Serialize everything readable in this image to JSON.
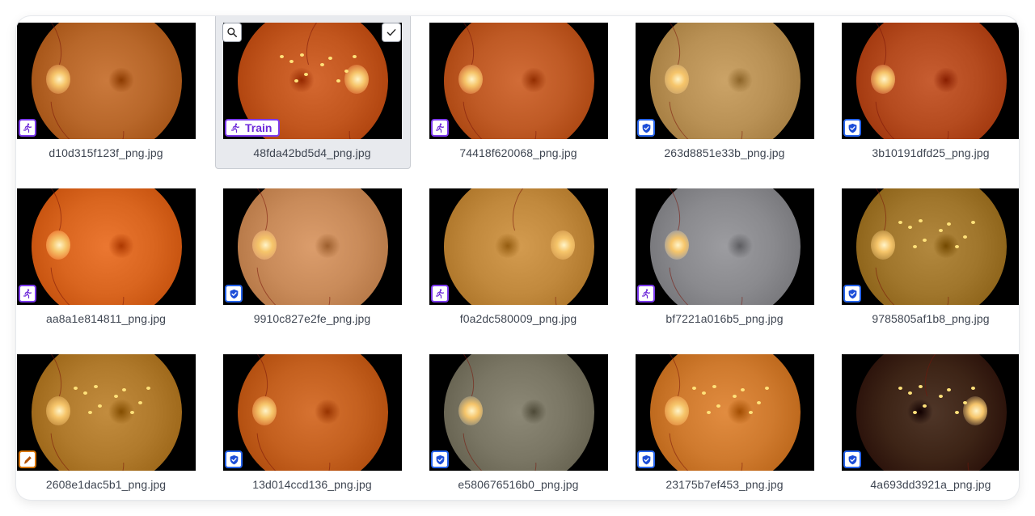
{
  "images": [
    {
      "filename": "d10d315f123f_png.jpg",
      "split": "train",
      "badge_icon": "running-person-icon",
      "tint": "#b8672a",
      "disc": "left",
      "lesions": false
    },
    {
      "filename": "48fda42bd5d4_png.jpg",
      "split": "train",
      "badge_icon": "running-person-icon",
      "badge_label": "Train",
      "selected": true,
      "tint": "#c2561e",
      "disc": "right",
      "lesions": true
    },
    {
      "filename": "74418f620068_png.jpg",
      "split": "train",
      "badge_icon": "running-person-icon",
      "tint": "#bf5a25",
      "disc": "left",
      "lesions": false
    },
    {
      "filename": "263d8851e33b_png.jpg",
      "split": "valid",
      "badge_icon": "shield-check-icon",
      "tint": "#b99155",
      "disc": "left",
      "lesions": false
    },
    {
      "filename": "3b10191dfd25_png.jpg",
      "split": "valid",
      "badge_icon": "shield-check-icon",
      "tint": "#b54b1f",
      "disc": "left",
      "lesions": false
    },
    {
      "filename": "aa8a1e814811_png.jpg",
      "split": "train",
      "badge_icon": "running-person-icon",
      "tint": "#d9651f",
      "disc": "left",
      "lesions": false
    },
    {
      "filename": "9910c827e2fe_png.jpg",
      "split": "valid",
      "badge_icon": "shield-check-icon",
      "tint": "#c98b5a",
      "disc": "left",
      "lesions": false
    },
    {
      "filename": "f0a2dc580009_png.jpg",
      "split": "train",
      "badge_icon": "running-person-icon",
      "tint": "#c1893d",
      "disc": "right",
      "lesions": false
    },
    {
      "filename": "bf7221a016b5_png.jpg",
      "split": "train",
      "badge_icon": "running-person-icon",
      "tint": "#8a8a8e",
      "disc": "left",
      "lesions": false
    },
    {
      "filename": "9785805af1b8_png.jpg",
      "split": "valid",
      "badge_icon": "shield-check-icon",
      "tint": "#a0762c",
      "disc": "left",
      "lesions": true
    },
    {
      "filename": "2608e1dac5b1_png.jpg",
      "split": "edit",
      "badge_icon": "pencil-icon",
      "tint": "#b07a2c",
      "disc": "left",
      "lesions": true
    },
    {
      "filename": "13d014ccd136_png.jpg",
      "split": "valid",
      "badge_icon": "shield-check-icon",
      "tint": "#c4601f",
      "disc": "left",
      "lesions": false
    },
    {
      "filename": "e580676516b0_png.jpg",
      "split": "valid",
      "badge_icon": "shield-check-icon",
      "tint": "#7a7664",
      "disc": "left",
      "lesions": false
    },
    {
      "filename": "23175b7ef453_png.jpg",
      "split": "valid",
      "badge_icon": "shield-check-icon",
      "tint": "#cf7a2e",
      "disc": "left",
      "lesions": true
    },
    {
      "filename": "4a693dd3921a_png.jpg",
      "split": "valid",
      "badge_icon": "shield-check-icon",
      "tint": "#3d2416",
      "disc": "right",
      "lesions": true
    }
  ],
  "colors": {
    "train": "#7c3aed",
    "valid": "#2563eb",
    "edit": "#d97706",
    "caption": "#3f4652"
  },
  "selected_tools": [
    "search-icon",
    "checkmark-icon"
  ]
}
